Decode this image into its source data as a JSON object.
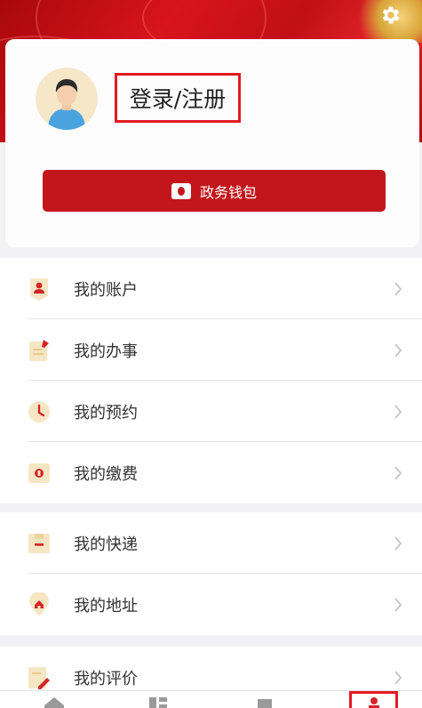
{
  "header": {
    "settings_icon": "gear-icon",
    "login_register_label": "登录/注册",
    "avatar_icon": "user-avatar-icon"
  },
  "wallet": {
    "label": "政务钱包",
    "icon": "wallet-icon"
  },
  "menu_groups": [
    {
      "items": [
        {
          "label": "我的账户",
          "icon": "account-icon"
        },
        {
          "label": "我的办事",
          "icon": "task-icon"
        },
        {
          "label": "我的预约",
          "icon": "clock-icon"
        },
        {
          "label": "我的缴费",
          "icon": "payment-icon"
        }
      ]
    },
    {
      "items": [
        {
          "label": "我的快递",
          "icon": "express-icon"
        },
        {
          "label": "我的地址",
          "icon": "location-icon"
        }
      ]
    },
    {
      "items": [
        {
          "label": "我的评价",
          "icon": "review-icon"
        }
      ]
    }
  ],
  "bottom_nav": {
    "items": [
      {
        "icon": "home-icon"
      },
      {
        "icon": "services-icon"
      },
      {
        "icon": "news-icon"
      },
      {
        "icon": "profile-icon",
        "active": true
      }
    ]
  },
  "colors": {
    "brand_red": "#c3161c",
    "highlight_red": "#e01b22",
    "icon_bg": "#f7e6c3",
    "icon_red": "#d4242a"
  }
}
